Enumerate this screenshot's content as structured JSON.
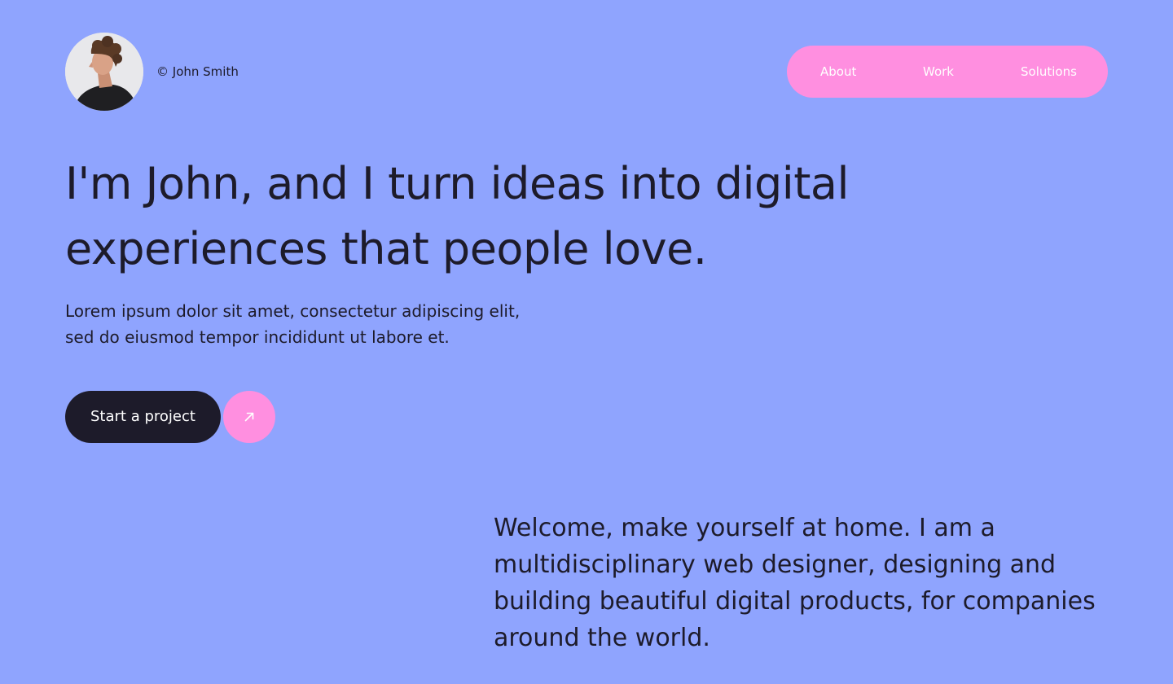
{
  "brand": {
    "name": "© John Smith"
  },
  "nav": {
    "items": [
      {
        "label": "About"
      },
      {
        "label": "Work"
      },
      {
        "label": "Solutions"
      }
    ]
  },
  "hero": {
    "title": "I'm John, and I turn ideas into digital experiences that people love.",
    "subtitle": "Lorem ipsum dolor sit amet, consectetur adipiscing elit, sed do eiusmod tempor incididunt ut labore et.",
    "cta_label": "Start a project",
    "cta_icon": "arrow-up-right-icon"
  },
  "welcome": {
    "text": "Welcome, make yourself at home. I am a multidisciplinary web designer, designing and building beautiful digital products, for companies around the world."
  },
  "colors": {
    "background": "#8fa4fe",
    "accent_pink": "#ff8fe0",
    "dark": "#1d1b2a",
    "white": "#ffffff"
  }
}
